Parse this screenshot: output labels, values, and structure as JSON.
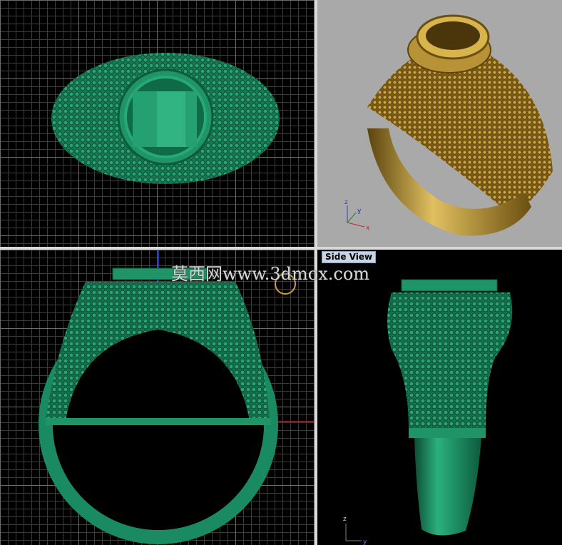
{
  "viewports": {
    "side": {
      "label": "Side View"
    },
    "perspective": {
      "axis_labels": {
        "z": "z",
        "y": "y",
        "x": "x"
      }
    },
    "side_axes": {
      "z": "z",
      "y": "y"
    }
  },
  "watermark": {
    "text": "莫西网www.3dmox.com"
  },
  "colors": {
    "model_green": "#1a8a62",
    "model_gold": "#b08a2a",
    "viewport_bg_dark": "#000000",
    "viewport_bg_persp": "#a9a9a9",
    "axis_red": "#c02424",
    "axis_blue": "#2a3fd0"
  }
}
